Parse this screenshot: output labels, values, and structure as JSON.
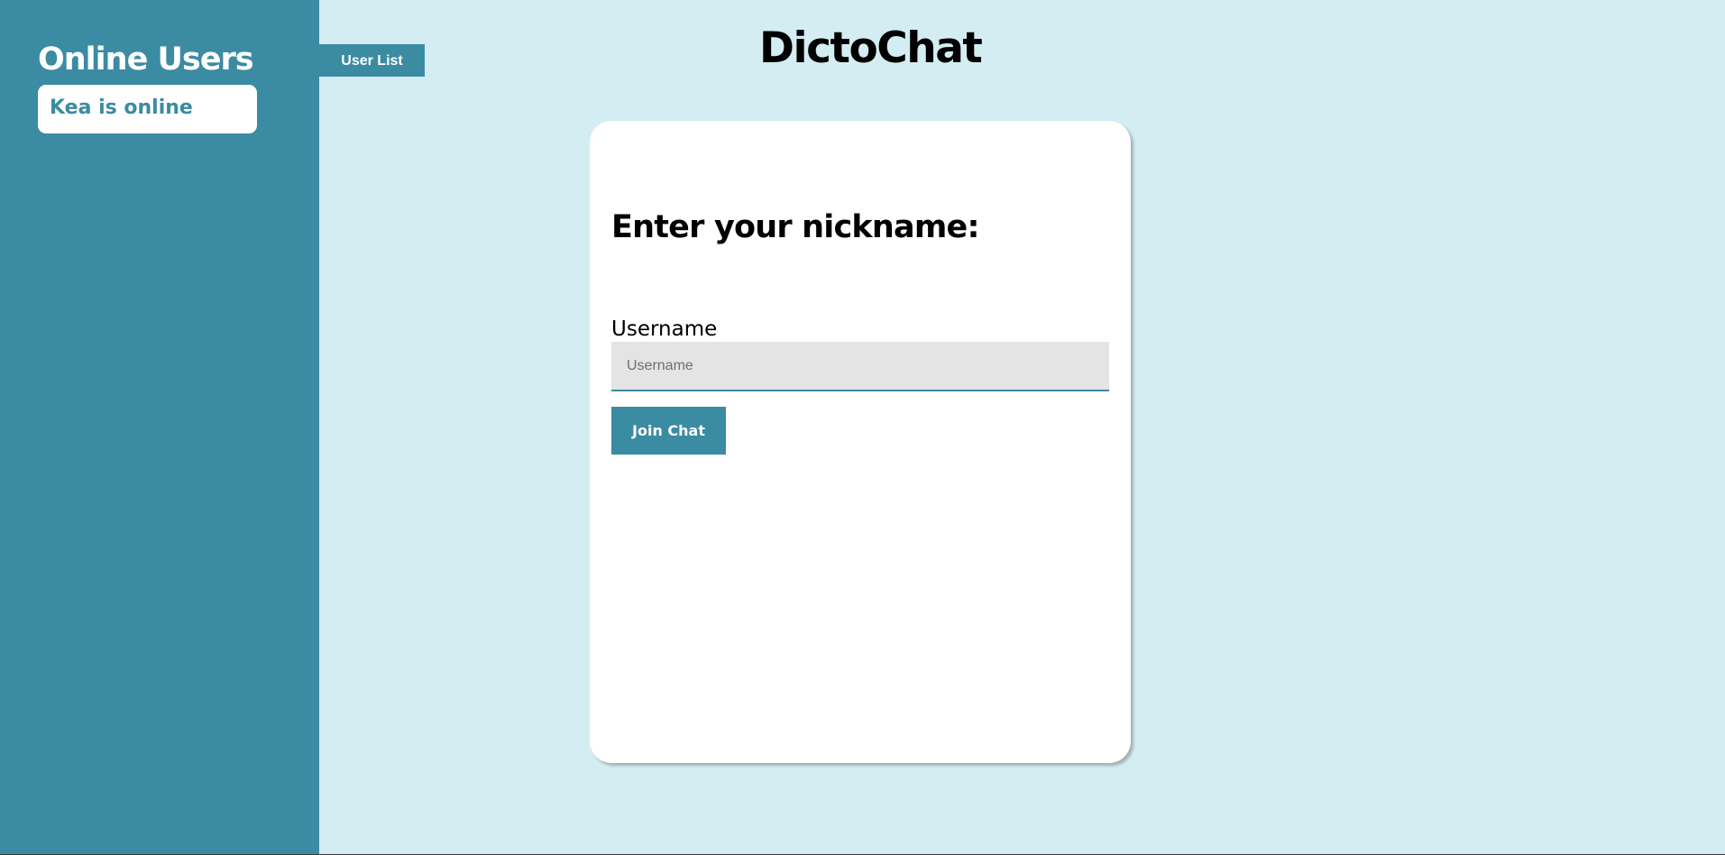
{
  "sidebar": {
    "title": "Online Users",
    "users": [
      {
        "status_text": "Kea is online"
      }
    ]
  },
  "tabs": {
    "user_list_label": "User List"
  },
  "header": {
    "app_title": "DictoChat"
  },
  "login_card": {
    "heading": "Enter your nickname:",
    "username_label": "Username",
    "username_placeholder": "Username",
    "username_value": "",
    "join_button_label": "Join Chat"
  },
  "colors": {
    "accent": "#3b8ba3",
    "page_background": "#d4edf2",
    "card_background": "#ffffff",
    "input_background": "#e4e4e4"
  }
}
